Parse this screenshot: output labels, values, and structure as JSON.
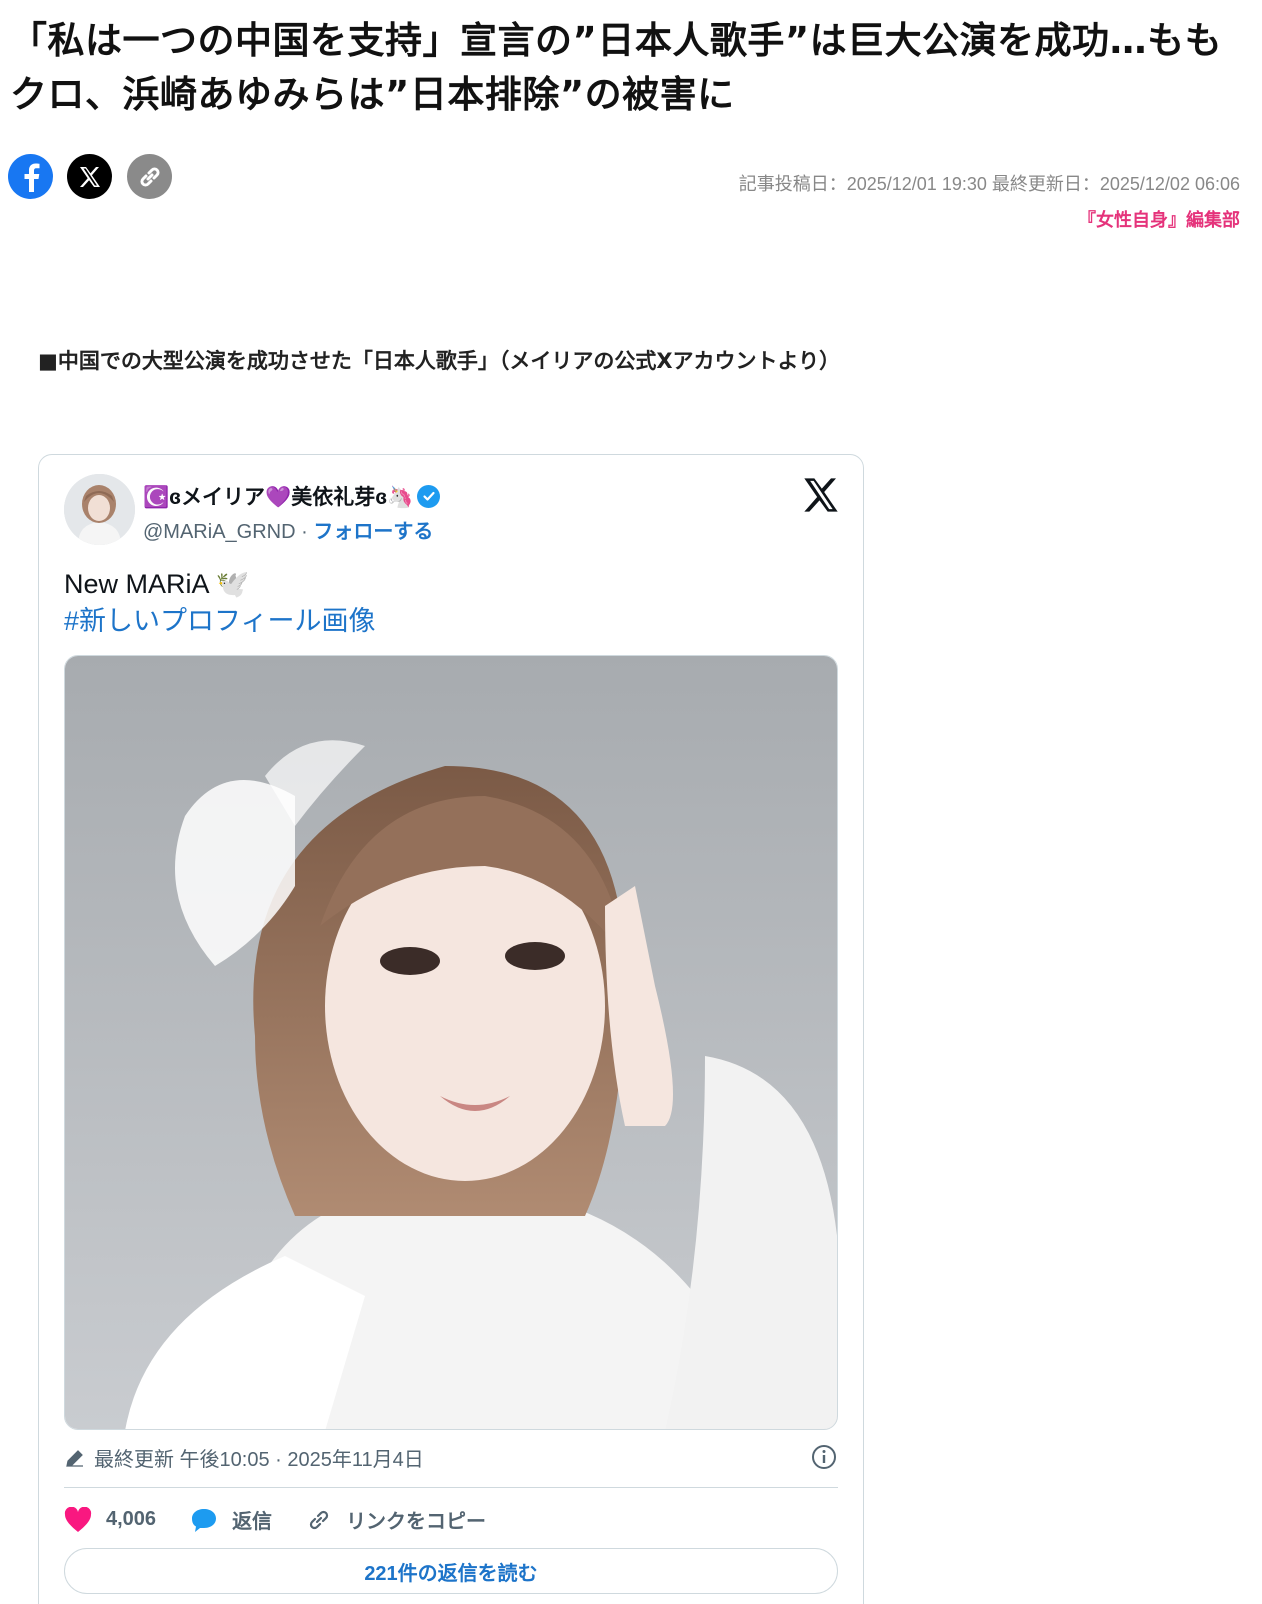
{
  "article": {
    "headline": "「私は一つの中国を支持」宣言の”日本人歌手”は巨大公演を成功…ももクロ、浜崎あゆみらは”日本排除”の被害に",
    "meta": "記事投稿日：2025/12/01 19:30 最終更新日：2025/12/02 06:06",
    "editor": "『女性自身』編集部",
    "caption": "■中国での大型公演を成功させた「日本人歌手」（メイリアの公式Xアカウントより）"
  },
  "share": {
    "facebook_icon": "facebook-icon",
    "x_icon": "x-icon",
    "link_icon": "link-icon"
  },
  "tweet": {
    "display_name": "☪️ɞメイリア💜美依礼芽ɞ🦄",
    "handle": "@MARiA_GRND",
    "separator": " · ",
    "follow": "フォローする",
    "text": "New MARiA 🕊️",
    "hashtag": "#新しいプロフィール画像",
    "timestamp": "最終更新 午後10:05 · 2025年11月4日",
    "likes": "4,006",
    "reply": "返信",
    "copy_link": "リンクをコピー",
    "read_replies": "221件の返信を読む"
  },
  "colors": {
    "facebook": "#1877f2",
    "accent_pink": "#e5337b",
    "twitter_blue": "#1d74c9",
    "verified": "#1d9bf0",
    "like_heart": "#f91880"
  }
}
